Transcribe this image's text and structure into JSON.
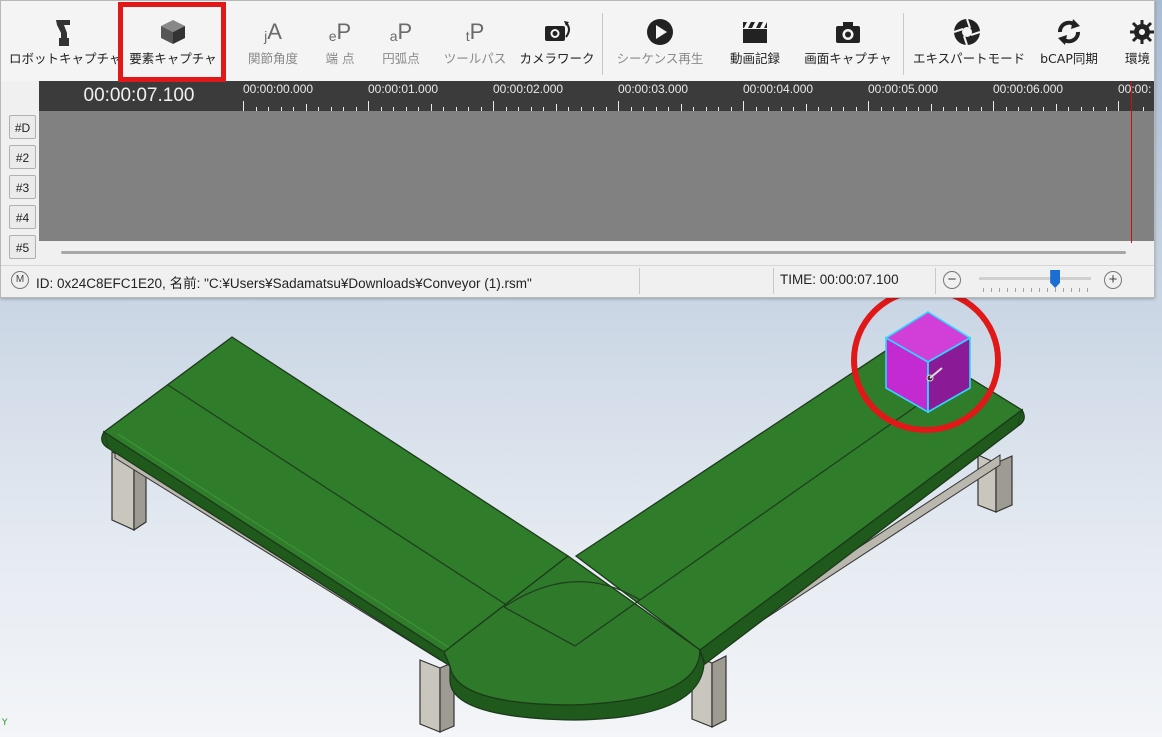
{
  "toolbar": {
    "items": [
      {
        "label": "ロボットキャプチャ",
        "icon": "robot-arm-icon",
        "enabled": true
      },
      {
        "label": "要素キャプチャ",
        "icon": "cube-icon",
        "enabled": true,
        "highlighted": true
      },
      {
        "label": "関節角度",
        "icon": "jA",
        "enabled": false
      },
      {
        "label": "端 点",
        "icon": "eP",
        "enabled": false
      },
      {
        "label": "円弧点",
        "icon": "aP",
        "enabled": false
      },
      {
        "label": "ツールパス",
        "icon": "tP",
        "enabled": false
      },
      {
        "label": "カメラワーク",
        "icon": "camera-rotate-icon",
        "enabled": true
      },
      {
        "label": "シーケンス再生",
        "icon": "play-circle-icon",
        "enabled": false
      },
      {
        "label": "動画記録",
        "icon": "clapperboard-icon",
        "enabled": true
      },
      {
        "label": "画面キャプチャ",
        "icon": "camera-icon",
        "enabled": true
      },
      {
        "label": "エキスパートモード",
        "icon": "aperture-icon",
        "enabled": true
      },
      {
        "label": "bCAP同期",
        "icon": "sync-icon",
        "enabled": true
      },
      {
        "label": "環境",
        "icon": "gear-icon",
        "enabled": true
      }
    ]
  },
  "timeline": {
    "current_time": "00:00:07.100",
    "ticks": [
      "00:00:00.000",
      "00:00:01.000",
      "00:00:02.000",
      "00:00:03.000",
      "00:00:04.000",
      "00:00:05.000",
      "00:00:06.000",
      "00:00:"
    ],
    "tracks": [
      "#D",
      "#2",
      "#3",
      "#4",
      "#5"
    ]
  },
  "status": {
    "mode_icon": "M",
    "text": "ID: 0x24C8EFC1E20, 名前: \"C:¥Users¥Sadamatsu¥Downloads¥Conveyor (1).rsm\"",
    "time": "TIME: 00:00:07.100",
    "zoom_minus": "−",
    "zoom_plus": "+",
    "zoom_level": 0.68
  },
  "viewport": {
    "axis_label": "Y",
    "conveyor_color": "#2e7d2a",
    "box_color": "#c82ad8",
    "highlight_color": "#e01818"
  }
}
